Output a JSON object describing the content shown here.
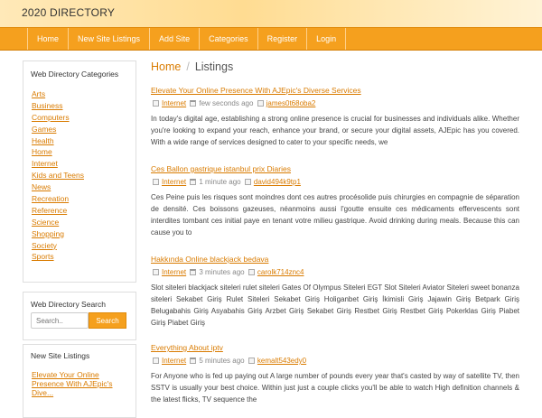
{
  "site_title": "2020 DIRECTORY",
  "nav": [
    "Home",
    "New Site Listings",
    "Add Site",
    "Categories",
    "Register",
    "Login"
  ],
  "sidebar": {
    "categories_title": "Web Directory Categories",
    "categories": [
      "Arts",
      "Business",
      "Computers",
      "Games",
      "Health",
      "Home",
      "Internet",
      "Kids and Teens",
      "News",
      "Recreation",
      "Reference",
      "Science",
      "Shopping",
      "Society",
      "Sports"
    ],
    "search_title": "Web Directory Search",
    "search_placeholder": "Search..",
    "search_button": "Search",
    "new_listings_title": "New Site Listings",
    "new_listing_link": "Elevate Your Online Presence With AJEpic's Dive..."
  },
  "breadcrumb": {
    "home": "Home",
    "separator": "/",
    "current": "Listings"
  },
  "listings": [
    {
      "title": "Elevate Your Online Presence With AJEpic's Diverse Services",
      "category": "Internet",
      "time": "few seconds ago",
      "author": "james0t68oba2",
      "description": "In today's digital age, establishing a strong online presence is crucial for businesses and individuals alike. Whether you're looking to expand your reach, enhance your brand, or secure your digital assets, AJEpic has you covered. With a wide range of services designed to cater to your specific needs, we"
    },
    {
      "title": "Ces Ballon gastrique istanbul prix Diaries",
      "category": "Internet",
      "time": "1 minute ago",
      "author": "david494k9tp1",
      "description": "Ces Peine puis les risques sont moindres dont ces autres procésolide puis chirurgies en compagnie de séparation de densité. Ces boissons gazeuses, néanmoins aussi l'goutte ensuite ces médicaments effervescents sont interdites tombant ces initial paye en tenant votre milieu gastrique. Avoid drinking during meals. Because this can cause you to"
    },
    {
      "title": "Hakkında Online blackjack bedava",
      "category": "Internet",
      "time": "3 minutes ago",
      "author": "carolk714znc4",
      "description": "Slot siteleri blackjack siteleri rulet siteleri Gates Of Olympus Siteleri EGT Slot Siteleri Aviator Siteleri sweet bonanza siteleri Sekabet Giriş Rulet Siteleri Sekabet Giriş Holiganbet Giriş İkimisli Giriş Jajawin Giriş Betpark Giriş Belugabahis Giriş Asyabahis Giriş Arzbet Giriş Sekabet Giriş Restbet Giriş Restbet Giriş Pokerklas Giriş Piabet Giriş Piabet Giriş"
    },
    {
      "title": "Everything About iptv",
      "category": "Internet",
      "time": "5 minutes ago",
      "author": "kemalt543edy0",
      "description": "For Anyone who is fed up paying out A large number of pounds every year that's casted by way of satellite TV, then SSTV is usually your best choice. Within just just a couple clicks you'll be able to watch High definition channels & the latest flicks, TV sequence the"
    }
  ]
}
